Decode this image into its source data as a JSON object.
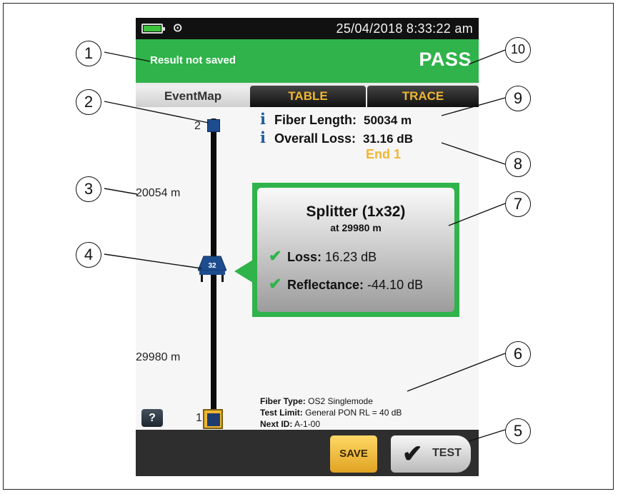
{
  "status_bar": {
    "datetime": "25/04/2018 8:33:22 am",
    "probe_icon": "probe-icon"
  },
  "result_bar": {
    "save_status": "Result not saved",
    "verdict": "PASS",
    "color": "#2fb34a"
  },
  "tabs": [
    {
      "label": "EventMap",
      "active": true
    },
    {
      "label": "TABLE",
      "active": false
    },
    {
      "label": "TRACE",
      "active": false
    }
  ],
  "event_map": {
    "far_end_label": "2",
    "near_end_label": "1",
    "segment_upper": "20054 m",
    "segment_lower": "29980 m",
    "splitter_badge": "32"
  },
  "summary": {
    "fiber_length_label": "Fiber Length:",
    "fiber_length_value": "50034 m",
    "overall_loss_label": "Overall Loss:",
    "overall_loss_value": "31.16 dB",
    "end_label": "End 1"
  },
  "event_card": {
    "title": "Splitter (1x32)",
    "position": "at 29980 m",
    "loss_label": "Loss:",
    "loss_value": "16.23 dB",
    "reflectance_label": "Reflectance:",
    "reflectance_value": "-44.10 dB"
  },
  "test_info": {
    "fiber_type_label": "Fiber Type:",
    "fiber_type_value": "OS2 Singlemode",
    "test_limit_label": "Test Limit:",
    "test_limit_value": "General PON RL = 40 dB",
    "next_id_label": "Next ID:",
    "next_id_value": "A-1-00"
  },
  "buttons": {
    "help": "?",
    "save": "SAVE",
    "test": "TEST"
  },
  "callouts": [
    "1",
    "2",
    "3",
    "4",
    "5",
    "6",
    "7",
    "8",
    "9",
    "10"
  ],
  "colors": {
    "accent_yellow": "#f0b632",
    "event_blue": "#1d4d8e",
    "pass_green": "#2fb34a"
  }
}
